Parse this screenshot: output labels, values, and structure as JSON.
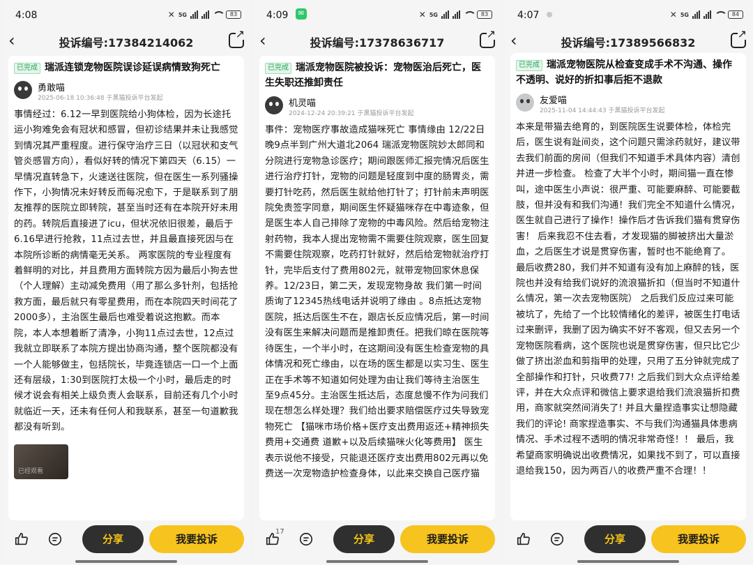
{
  "colors": {
    "accent": "#f7c31e",
    "share_btn_bg": "#2f2f2f",
    "share_btn_text": "#f5c515",
    "badge_green": "#2aa35c"
  },
  "common": {
    "badge": "已完成",
    "share_label": "分享",
    "complain_label": "我要投诉",
    "like_icon": "thumbs-up-icon",
    "comment_icon": "comment-icon",
    "back_icon": "chevron-left-icon",
    "share_icon": "share-out-icon"
  },
  "phones": [
    {
      "time": "4:08",
      "battery": "83",
      "network": "5G",
      "nav_title": "投诉编号:17384214062",
      "title": "瑞派连锁宠物医院误诊延误病情致狗死亡",
      "author": "勇敢喵",
      "meta": "2025-06-18 10:36:48 于黑猫投诉平台发起",
      "body": "事情经过：6.12一早到医院给小狗体检，因为长途托运小狗难免会有冠状和感冒，但初诊结果并未让我感觉到情况其严重程度。进行保守治疗三日（以冠状和支气管炎感冒方向），看似好转的情况下第四天（6.15）一早情况直转急下，火速送往医院，但在医生一系列骚操作下，小狗情况未好转反而每况愈下，于是联系到了朋友推荐的医院立即转院，甚至当时还有在本院开好未用的药。转院后直接进了icu，但状况依旧很差，最后于6.16早进行抢救，11点过去世，并且最直接死因与在本院所诊断的病情毫无关系。 两家医院的专业程度有着鲜明的对比，并且费用方面转院方因为最后小狗去世（个人理解）主动减免费用（用了那么多针剂，包括抢救方面，最后就只有零星费用，而在本院四天时间花了2000多），主治医生最后也难受着说这抱歉。而本院，本人本想着断了清净，小狗11点过去世，12点过我就立即联系了本院方提出协商沟通，整个医院都没有一个人能够做主，包括院长，毕竟连锁店一口一个上面还有层级，1:30到医院打太极一个小时，最后走的时候才说会有相关上级负责人会联系，目前还有几个小时就临近一天，还未有任何人和我联系，甚至一句道歉我都没有听到。",
      "thumb_text": "已经观看",
      "like_count": ""
    },
    {
      "time": "4:09",
      "battery": "83",
      "network": "5G",
      "nav_title": "投诉编号:17378636717",
      "title": "瑞派宠物医院被投诉：宠物医治后死亡，医生失职还推卸责任",
      "author": "机灵喵",
      "meta": "2024-12-24 20:39:21 于黑猫投诉平台发起",
      "body": "事件：宠物医疗事故造成猫咪死亡 事情缘由 12/22日晚9点半到广州大道北2064 瑞派宠物医院妙太郎同和分院进行宠物急诊医疗；期间跟医师汇报完情况后医生进行治疗打针，宠物的问题是轻度到中度的肠胃炎，需要打针吃药，然后医生就给他打针了；打针前未声明医院免责签字同意，期间医生怀疑猫咪存在中毒迹象，但是医生本人自己排除了宠物的中毒风险。然后给宠物注射药物，我本人提出宠物需不需要住院观察，医生回复不需要住院观察，吃药打针就好，然后给宠物就治疗打针，完毕后支付了费用802元，就带宠物回家休息保养。12/23日，第二天，发现宠物身故 我们第一时间质询了12345热线电话并说明了缘由 。8点抵达宠物医院，抵达后医生不在，跟店长反应情况后，第一时间没有医生来解决问题而是推卸责任。把我们晾在医院等待医生，一个半小时，在这期间没有医生检查宠物的具体情况和死亡缘由，以在场的医生都是以实习生、医生正在手术等不知道如何处理为由让我们等待主治医生 至9点45分。主治医生抵达后，态度怠慢不作为问我们 现在想怎么样处理？我们给出要求赔偿医疗过失导致宠物死亡 【猫咪市场价格+医疗支出费用返还+精神损失费用+交通费 道歉+以及后续猫咪火化等费用】 医生表示说他不接受，只能退还医疗支出费用802元再以免费送一次宠物造护检查身体，以此来交换自己医疗猫",
      "thumb_text": "",
      "like_count": "17"
    },
    {
      "time": "4:07",
      "battery": "84",
      "network": "5G",
      "nav_title": "投诉编号:17389566832",
      "title": "瑞派宠物医院从检查变成手术不沟通、操作不透明、说好的折扣事后拒不退款",
      "author": "友爱喵",
      "meta": "2025-11-04 14:44:43 于黑猫投诉平台发起",
      "body": "本来是带猫去绝育的，到医院医生说要体检，体检完后，医生说有趾间炎，这个问题只需涂药就好，建议带去我们前面的房间（但我们不知道手术具体内容）清创并进一步检查。 检查了大半个小时，期间猫一直在惨叫，途中医生小声说：很严重、可能要麻醉、可能要截肢，但并没有和我们沟通！我们完全不知道什么情况，医生就自己进行了操作！操作后才告诉我们猫有贯穿伤害！ 后来我忍不住去看，才发现猫的脚被挤出大量淤血，之后医生才说是贯穿伤害，暂时也不能绝育了。 最后收费280，我们并不知道有没有加上麻醉的钱，医院也并没有给我们说好的流浪猫折扣（但当时不知道什么情况，第一次去宠物医院） 之后我们反应过来可能被坑了，先给了一个比较情绪化的差评，被医生打电话过来删评，我删了因为确实不好不客观，但又去另一个宠物医院看病，这个医院也说是贯穿伤害，但只比它少做了挤出淤血和剪指甲的处理，只用了五分钟就完成了全部操作和打针，只收费77! 之后我们到大众点评给差评，并在大众点评和微信上要求退给我们流浪猫折扣费用，商家就突然间消失了! 并且大量捏造事实让想隐藏我们的评论! 商家捏造事实、不与我们沟通猫具体患病情况、手术过程不透明的情况非常奇怪！！ 最后，我希望商家明确说出收费情况，如果找不到了，可以直接退给我150，因为两百八的收费严重不合理！！",
      "thumb_text": "",
      "like_count": ""
    }
  ]
}
